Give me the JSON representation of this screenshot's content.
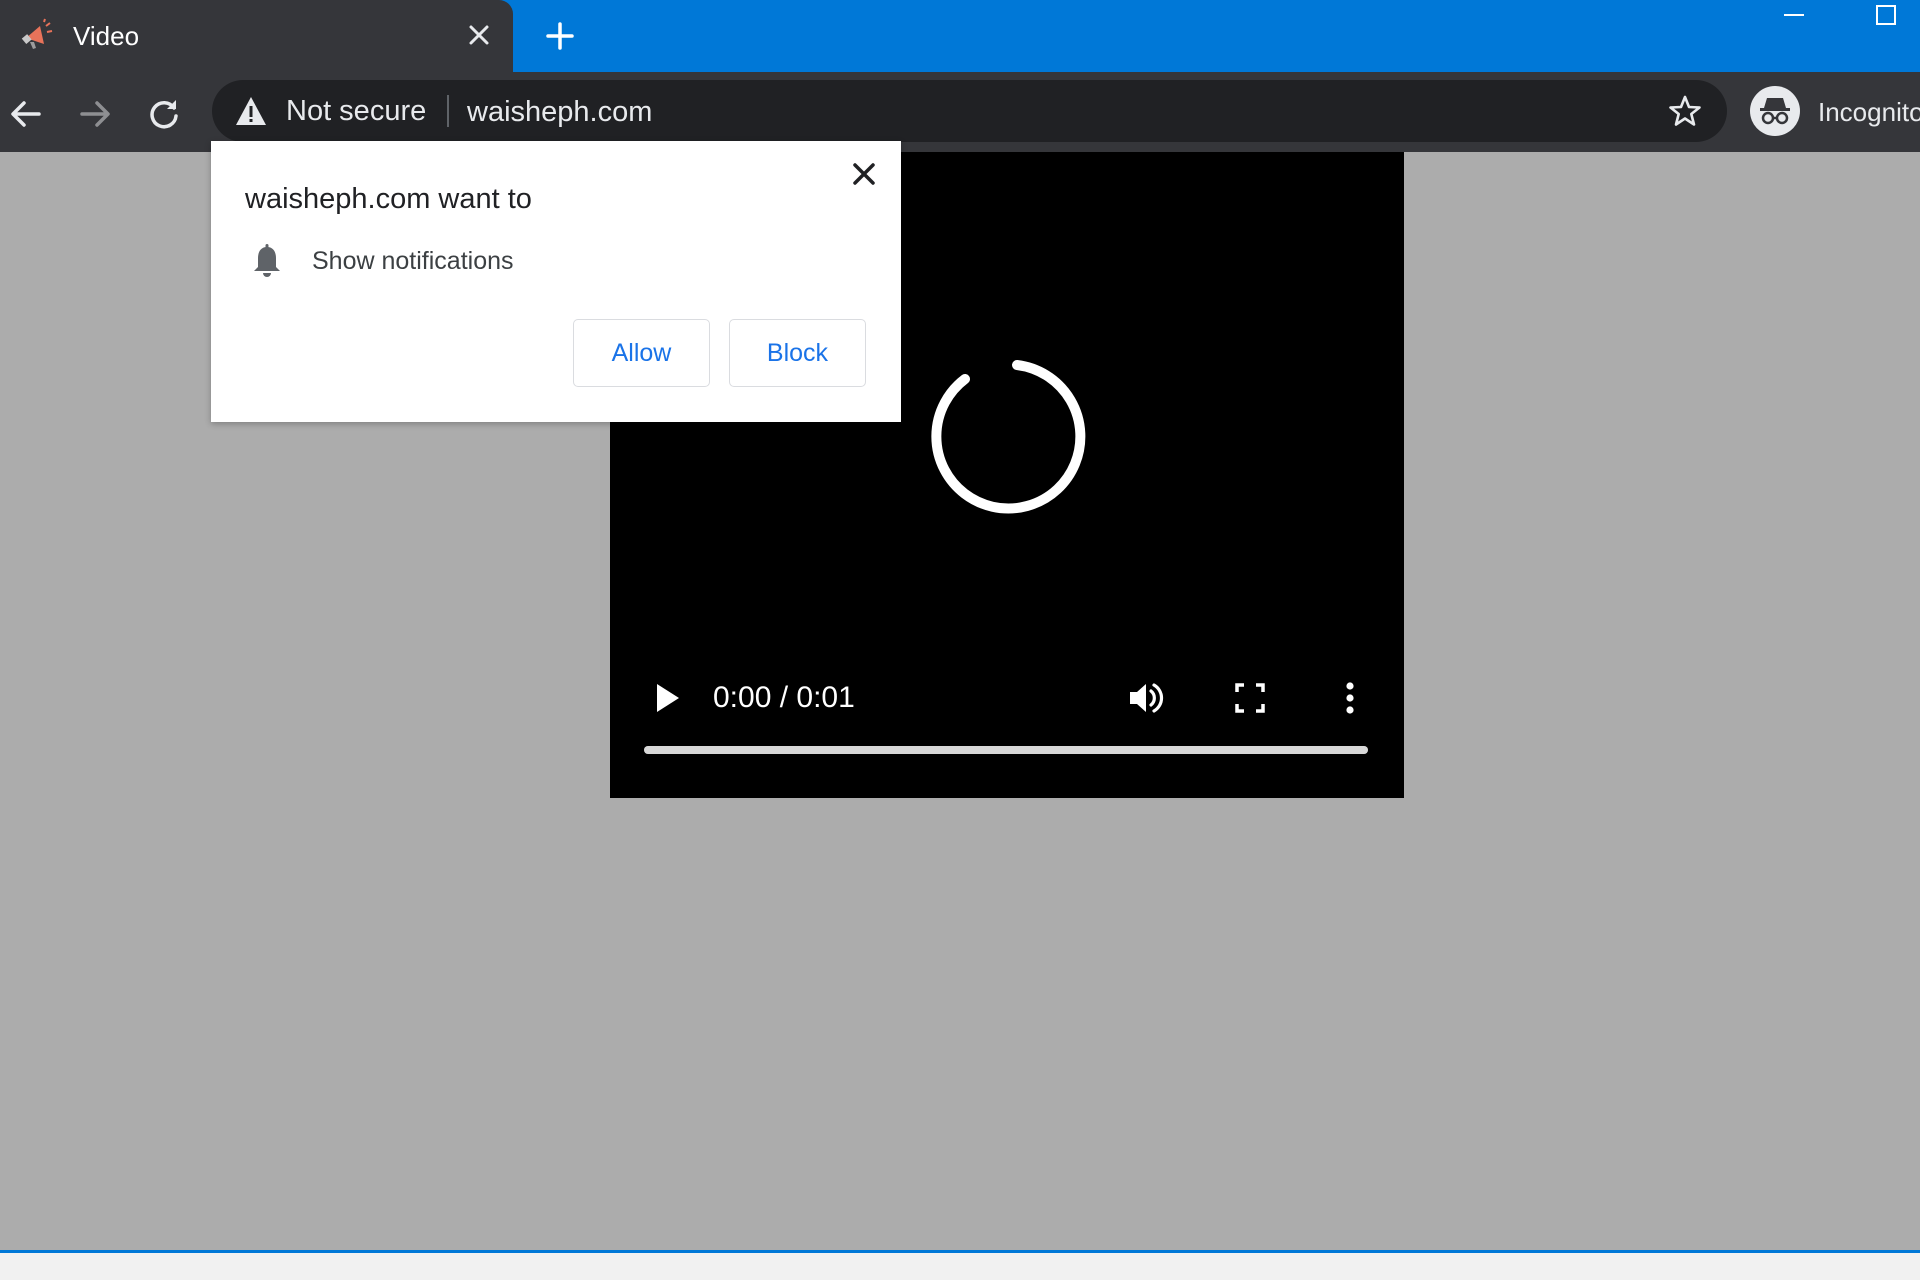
{
  "tab": {
    "title": "Video"
  },
  "toolbar": {
    "security_label": "Not secure",
    "url": "waisheph.com",
    "profile_label": "Incognito"
  },
  "popup": {
    "title": "waisheph.com want to",
    "permission": "Show notifications",
    "allow_label": "Allow",
    "block_label": "Block"
  },
  "video": {
    "time": "0:00 / 0:01",
    "progress_fraction": 1.0
  },
  "colors": {
    "tab_strip": "#0078d7",
    "toolbar": "#35363a",
    "omnibox": "#202124",
    "page_background": "#acacac",
    "button_text": "#1a73e8"
  },
  "icons": {
    "tab_favicon": "megaphone-icon",
    "tab_close": "close-icon",
    "new_tab": "plus-icon",
    "back": "arrow-left-icon",
    "forward": "arrow-right-icon",
    "reload": "reload-icon",
    "security": "warning-triangle-icon",
    "bookmark": "star-icon",
    "profile": "incognito-icon",
    "popup_close": "close-icon",
    "permission": "bell-icon",
    "play": "play-icon",
    "volume": "volume-icon",
    "fullscreen": "fullscreen-icon",
    "more": "more-vertical-icon",
    "loading": "spinner-icon"
  }
}
